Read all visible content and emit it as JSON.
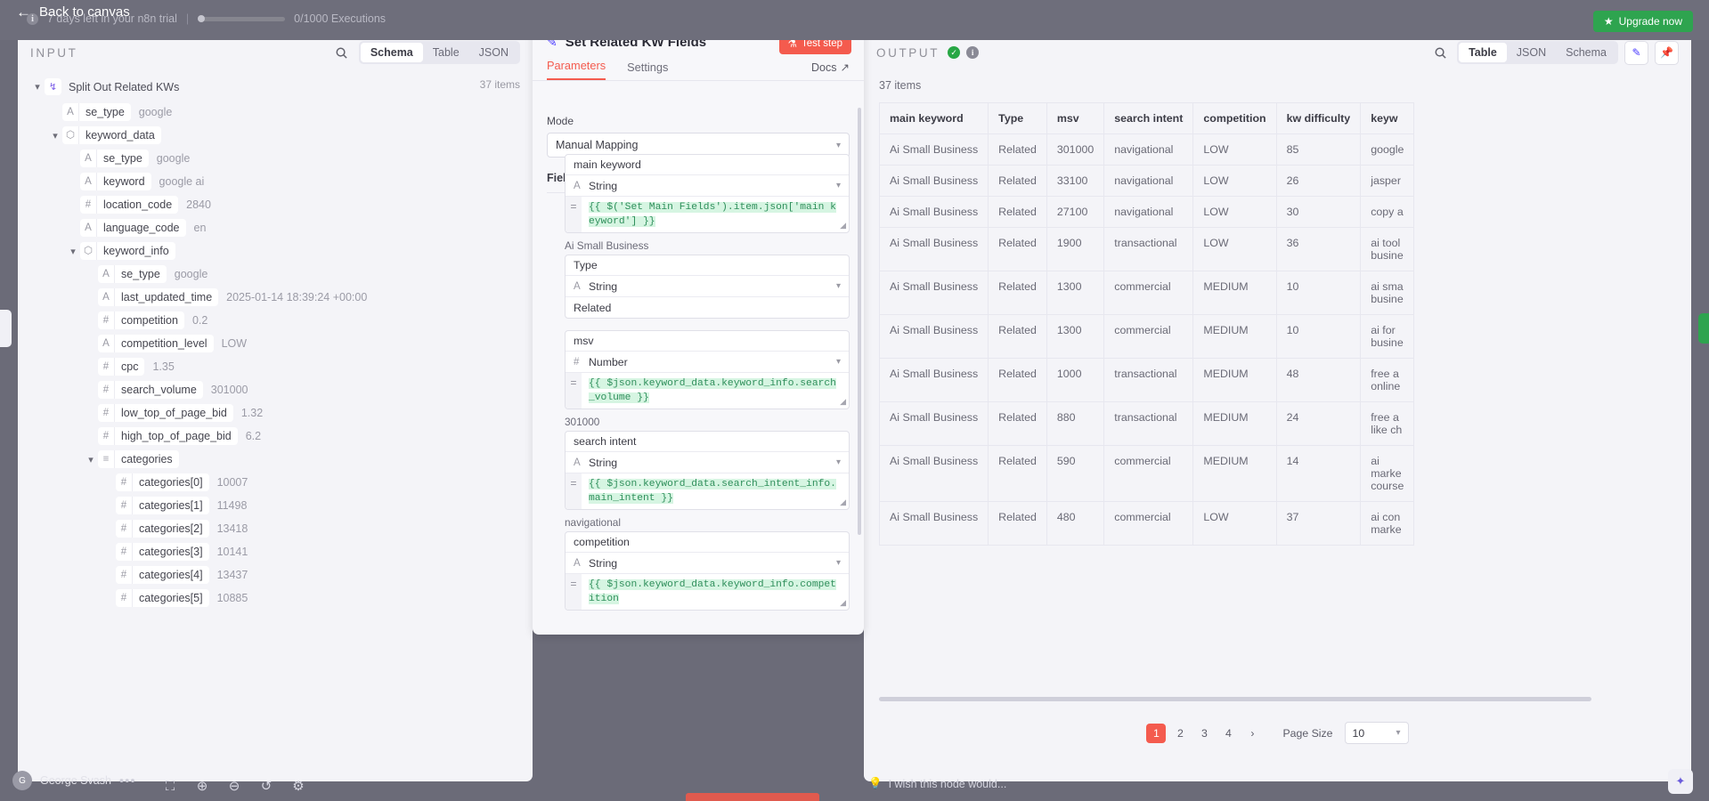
{
  "topbar": {
    "back_label": "Back to canvas",
    "back_icon": "arrow-left-icon",
    "trial_text": "7 days left in your n8n trial",
    "executions_text": "0/1000 Executions",
    "upgrade_label": "Upgrade now",
    "upgrade_icon": "gift-icon",
    "info_icon": "i"
  },
  "input_panel": {
    "title": "INPUT",
    "search_icon": "search-icon",
    "tabs": [
      {
        "label": "Schema",
        "active": true
      },
      {
        "label": "Table",
        "active": false
      },
      {
        "label": "JSON",
        "active": false
      }
    ],
    "node_name": "Split Out Related KWs",
    "items_count": "37 items",
    "tree": [
      {
        "indent": 1,
        "type": "A",
        "name": "se_type",
        "value": "google"
      },
      {
        "indent": 1,
        "type": "obj",
        "name": "keyword_data",
        "value": "",
        "caret": true
      },
      {
        "indent": 2,
        "type": "A",
        "name": "se_type",
        "value": "google"
      },
      {
        "indent": 2,
        "type": "A",
        "name": "keyword",
        "value": "google ai"
      },
      {
        "indent": 2,
        "type": "#",
        "name": "location_code",
        "value": "2840"
      },
      {
        "indent": 2,
        "type": "A",
        "name": "language_code",
        "value": "en"
      },
      {
        "indent": 2,
        "type": "obj",
        "name": "keyword_info",
        "value": "",
        "caret": true
      },
      {
        "indent": 3,
        "type": "A",
        "name": "se_type",
        "value": "google"
      },
      {
        "indent": 3,
        "type": "A",
        "name": "last_updated_time",
        "value": "2025-01-14 18:39:24 +00:00"
      },
      {
        "indent": 3,
        "type": "#",
        "name": "competition",
        "value": "0.2"
      },
      {
        "indent": 3,
        "type": "A",
        "name": "competition_level",
        "value": "LOW"
      },
      {
        "indent": 3,
        "type": "#",
        "name": "cpc",
        "value": "1.35"
      },
      {
        "indent": 3,
        "type": "#",
        "name": "search_volume",
        "value": "301000"
      },
      {
        "indent": 3,
        "type": "#",
        "name": "low_top_of_page_bid",
        "value": "1.32"
      },
      {
        "indent": 3,
        "type": "#",
        "name": "high_top_of_page_bid",
        "value": "6.2"
      },
      {
        "indent": 3,
        "type": "list",
        "name": "categories",
        "value": "",
        "caret": true
      },
      {
        "indent": 4,
        "type": "#",
        "name": "categories[0]",
        "value": "10007"
      },
      {
        "indent": 4,
        "type": "#",
        "name": "categories[1]",
        "value": "11498"
      },
      {
        "indent": 4,
        "type": "#",
        "name": "categories[2]",
        "value": "13418"
      },
      {
        "indent": 4,
        "type": "#",
        "name": "categories[3]",
        "value": "10141"
      },
      {
        "indent": 4,
        "type": "#",
        "name": "categories[4]",
        "value": "13437"
      },
      {
        "indent": 4,
        "type": "#",
        "name": "categories[5]",
        "value": "10885"
      }
    ]
  },
  "modal": {
    "title": "Set Related KW Fields",
    "pencil_icon": "pencil-icon",
    "test_step_label": "Test step",
    "test_step_icon": "flask-icon",
    "tabs": [
      {
        "label": "Parameters",
        "active": true
      },
      {
        "label": "Settings",
        "active": false
      }
    ],
    "docs_label": "Docs",
    "docs_icon": "external-link-icon",
    "mode_label": "Mode",
    "mode_value": "Manual Mapping",
    "fields_to_set_label": "Fields to Set",
    "fields": [
      {
        "name": "main keyword",
        "type": "String",
        "type_glyph": "A",
        "expression": "{{ $('Set Main Fields').item.json['main keyword'] }}",
        "resolved": "Ai Small Business",
        "is_expression": true
      },
      {
        "name": "Type",
        "type": "String",
        "type_glyph": "A",
        "plain_value": "Related",
        "is_expression": false
      },
      {
        "name": "msv",
        "type": "Number",
        "type_glyph": "#",
        "expression": "{{ $json.keyword_data.keyword_info.search_volume }}",
        "resolved": "301000",
        "is_expression": true
      },
      {
        "name": "search intent",
        "type": "String",
        "type_glyph": "A",
        "expression": "{{ $json.keyword_data.search_intent_info.main_intent }}",
        "resolved": "navigational",
        "is_expression": true
      },
      {
        "name": "competition",
        "type": "String",
        "type_glyph": "A",
        "expression": "{{ $json.keyword_data.keyword_info.competition",
        "resolved": "",
        "is_expression": true
      }
    ]
  },
  "output_panel": {
    "title": "OUTPUT",
    "status_icon": "check-circle-icon",
    "info_icon": "info-icon",
    "search_icon": "search-icon",
    "edit_icon": "pencil-icon",
    "pin_icon": "pin-icon",
    "tabs": [
      {
        "label": "Table",
        "active": true
      },
      {
        "label": "JSON",
        "active": false
      },
      {
        "label": "Schema",
        "active": false
      }
    ],
    "items_count": "37 items",
    "table": {
      "columns": [
        "main keyword",
        "Type",
        "msv",
        "search intent",
        "competition",
        "kw difficulty",
        "keyw"
      ],
      "rows": [
        [
          "Ai Small Business",
          "Related",
          "301000",
          "navigational",
          "LOW",
          "85",
          "google"
        ],
        [
          "Ai Small Business",
          "Related",
          "33100",
          "navigational",
          "LOW",
          "26",
          "jasper"
        ],
        [
          "Ai Small Business",
          "Related",
          "27100",
          "navigational",
          "LOW",
          "30",
          "copy a"
        ],
        [
          "Ai Small Business",
          "Related",
          "1900",
          "transactional",
          "LOW",
          "36",
          "ai tool\nbusine"
        ],
        [
          "Ai Small Business",
          "Related",
          "1300",
          "commercial",
          "MEDIUM",
          "10",
          "ai sma\nbusine"
        ],
        [
          "Ai Small Business",
          "Related",
          "1300",
          "commercial",
          "MEDIUM",
          "10",
          "ai for\nbusine"
        ],
        [
          "Ai Small Business",
          "Related",
          "1000",
          "transactional",
          "MEDIUM",
          "48",
          "free a\nonline"
        ],
        [
          "Ai Small Business",
          "Related",
          "880",
          "transactional",
          "MEDIUM",
          "24",
          "free a\nlike ch"
        ],
        [
          "Ai Small Business",
          "Related",
          "590",
          "commercial",
          "MEDIUM",
          "14",
          "ai\nmarke\ncourse"
        ],
        [
          "Ai Small Business",
          "Related",
          "480",
          "commercial",
          "LOW",
          "37",
          "ai con\nmarke"
        ]
      ]
    },
    "pagination": {
      "pages": [
        "1",
        "2",
        "3",
        "4"
      ],
      "active_page": "1",
      "next_icon": "chevron-right-icon",
      "page_size_label": "Page Size",
      "page_size_value": "10"
    }
  },
  "bottombar": {
    "user_name": "George Svash",
    "user_initial": "G",
    "menu_dots": "•••",
    "tools": [
      "fit-view-icon",
      "zoom-in-icon",
      "zoom-out-icon",
      "reset-zoom-icon",
      "tidy-up-icon"
    ],
    "chat_hint": "I wish this node would...",
    "chat_icon": "lightbulb-icon",
    "ai_icon": "sparkle-icon"
  }
}
